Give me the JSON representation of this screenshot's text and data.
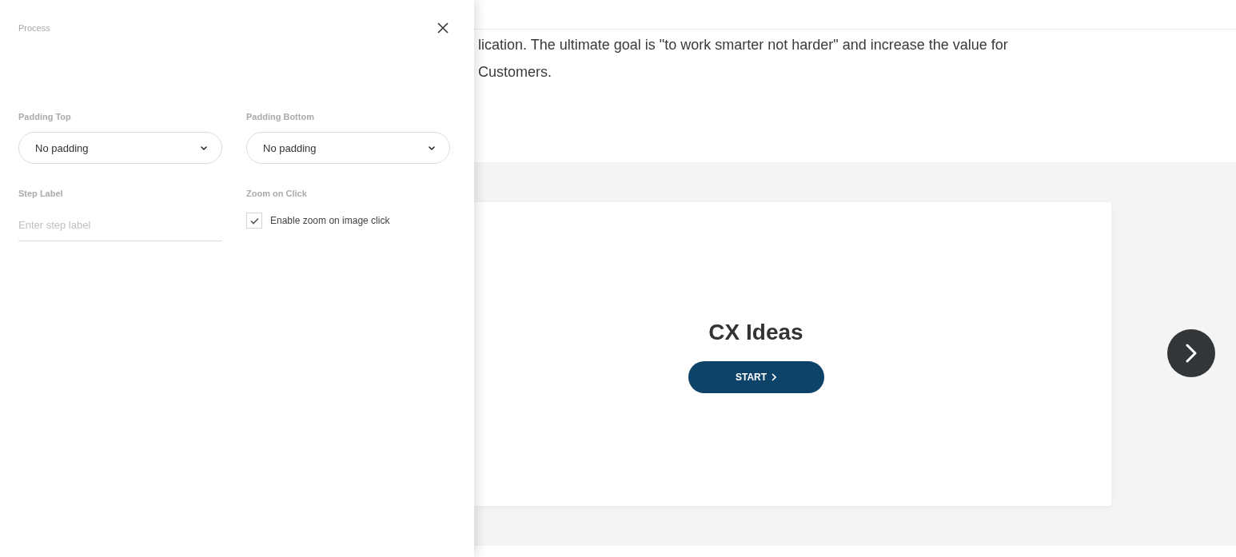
{
  "panel": {
    "title": "Process",
    "fields": [
      {
        "kind": "select",
        "label": "Padding Top",
        "value": "No padding"
      },
      {
        "kind": "select",
        "label": "Padding Bottom",
        "value": "No padding"
      },
      {
        "kind": "text",
        "label": "Step Label",
        "placeholder": "Enter step label"
      },
      {
        "kind": "checkbox",
        "label": "Zoom on Click",
        "option": "Enable zoom on image click",
        "checked": true
      }
    ]
  },
  "page": {
    "intro_lines": [
      "lication. The ultimate goal is \"to work smarter not harder\" and increase the value for",
      "Customers."
    ],
    "slide": {
      "title": "CX Ideas",
      "button": "START"
    }
  }
}
